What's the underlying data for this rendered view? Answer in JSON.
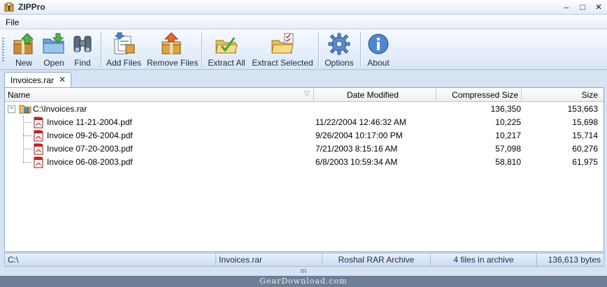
{
  "window": {
    "title": "ZIPPro",
    "controls": [
      "minimize",
      "maximize",
      "close"
    ]
  },
  "menu": {
    "items": [
      {
        "label": "File"
      }
    ]
  },
  "toolbar": {
    "buttons": [
      {
        "label": "New",
        "icon": "new-archive-icon"
      },
      {
        "label": "Open",
        "icon": "open-folder-icon"
      },
      {
        "label": "Find",
        "icon": "binoculars-icon"
      },
      {
        "label": "Add Files",
        "icon": "add-files-icon"
      },
      {
        "label": "Remove Files",
        "icon": "remove-files-icon"
      },
      {
        "label": "Extract All",
        "icon": "extract-all-icon"
      },
      {
        "label": "Extract Selected",
        "icon": "extract-selected-icon"
      },
      {
        "label": "Options",
        "icon": "gear-icon"
      },
      {
        "label": "About",
        "icon": "info-icon"
      }
    ]
  },
  "tabs": [
    {
      "label": "Invoices.rar",
      "close": "✕"
    }
  ],
  "columns": [
    "Name",
    "Date Modified",
    "Compressed Size",
    "Size"
  ],
  "tree": {
    "expander": "−",
    "root": {
      "name": "C:\\Invoices.rar",
      "date": "",
      "compressed": "136,350",
      "size": "153,663"
    },
    "files": [
      {
        "name": "Invoice 11-21-2004.pdf",
        "date": "11/22/2004 12:46:32 AM",
        "compressed": "10,225",
        "size": "15,698"
      },
      {
        "name": "Invoice 09-26-2004.pdf",
        "date": "9/26/2004 10:17:00 PM",
        "compressed": "10,217",
        "size": "15,714"
      },
      {
        "name": "Invoice 07-20-2003.pdf",
        "date": "7/21/2003 8:15:16 AM",
        "compressed": "57,098",
        "size": "60,276"
      },
      {
        "name": "Invoice 06-08-2003.pdf",
        "date": "6/8/2003 10:59:34 AM",
        "compressed": "58,810",
        "size": "61,975"
      }
    ]
  },
  "status": {
    "path": "C:\\",
    "archive": "Invoices.rar",
    "type": "Roshal RAR Archive",
    "count": "4 files in archive",
    "bytes": "136,613 bytes"
  },
  "watermark": "GearDownload.com",
  "colors": {
    "chrome": "#d6e3f3",
    "accent": "#1a2a44",
    "status_text": "#15305a"
  }
}
